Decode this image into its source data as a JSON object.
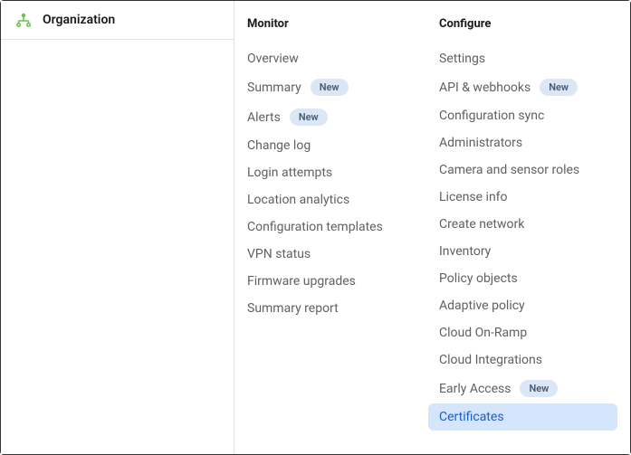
{
  "sidebar": {
    "title": "Organization"
  },
  "columns": [
    {
      "header": "Monitor",
      "items": [
        {
          "label": "Overview",
          "badge": null,
          "selected": false
        },
        {
          "label": "Summary",
          "badge": "New",
          "selected": false
        },
        {
          "label": "Alerts",
          "badge": "New",
          "selected": false
        },
        {
          "label": "Change log",
          "badge": null,
          "selected": false
        },
        {
          "label": "Login attempts",
          "badge": null,
          "selected": false
        },
        {
          "label": "Location analytics",
          "badge": null,
          "selected": false
        },
        {
          "label": "Configuration templates",
          "badge": null,
          "selected": false
        },
        {
          "label": "VPN status",
          "badge": null,
          "selected": false
        },
        {
          "label": "Firmware upgrades",
          "badge": null,
          "selected": false
        },
        {
          "label": "Summary report",
          "badge": null,
          "selected": false
        }
      ]
    },
    {
      "header": "Configure",
      "items": [
        {
          "label": "Settings",
          "badge": null,
          "selected": false
        },
        {
          "label": "API & webhooks",
          "badge": "New",
          "selected": false
        },
        {
          "label": "Configuration sync",
          "badge": null,
          "selected": false
        },
        {
          "label": "Administrators",
          "badge": null,
          "selected": false
        },
        {
          "label": "Camera and sensor roles",
          "badge": null,
          "selected": false
        },
        {
          "label": "License info",
          "badge": null,
          "selected": false
        },
        {
          "label": "Create network",
          "badge": null,
          "selected": false
        },
        {
          "label": "Inventory",
          "badge": null,
          "selected": false
        },
        {
          "label": "Policy objects",
          "badge": null,
          "selected": false
        },
        {
          "label": "Adaptive policy",
          "badge": null,
          "selected": false
        },
        {
          "label": "Cloud On-Ramp",
          "badge": null,
          "selected": false
        },
        {
          "label": "Cloud Integrations",
          "badge": null,
          "selected": false
        },
        {
          "label": "Early Access",
          "badge": "New",
          "selected": false
        },
        {
          "label": "Certificates",
          "badge": null,
          "selected": true
        }
      ]
    }
  ]
}
